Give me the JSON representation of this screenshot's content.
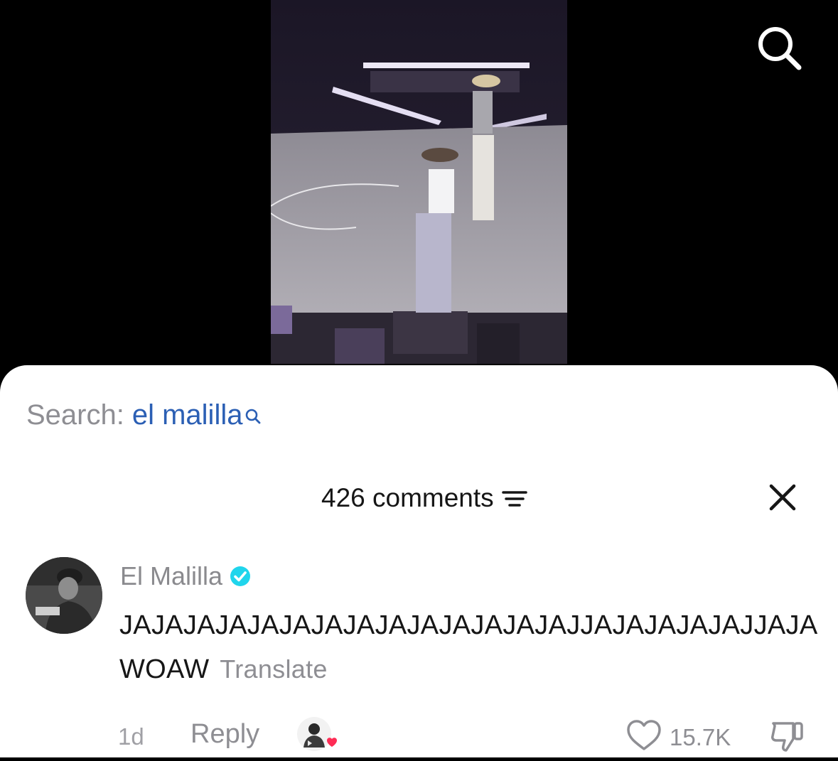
{
  "video": {
    "icons": {
      "search": "search-icon"
    }
  },
  "sheet": {
    "search": {
      "prefix": "Search:",
      "term": "el malilla",
      "icon": "search-small-icon"
    },
    "header": {
      "comment_count": "426 comments",
      "filter_icon": "filter-icon",
      "close_icon": "close-icon"
    },
    "comment": {
      "author": "El Malilla",
      "verified_icon": "verified-badge-icon",
      "text": "JAJAJAJAJAJAJAJAJAJAJAJAJAJAJJAJAJAJAJAJJAJA WOAW",
      "translate_label": "Translate",
      "time": "1d",
      "reply_label": "Reply",
      "like_count": "15.7K",
      "like_icon": "heart-icon",
      "dislike_icon": "dislike-icon",
      "colors": {
        "verified": "#20d5ec",
        "heart": "#fe2c55",
        "search_term": "#2b5fb4"
      }
    }
  }
}
